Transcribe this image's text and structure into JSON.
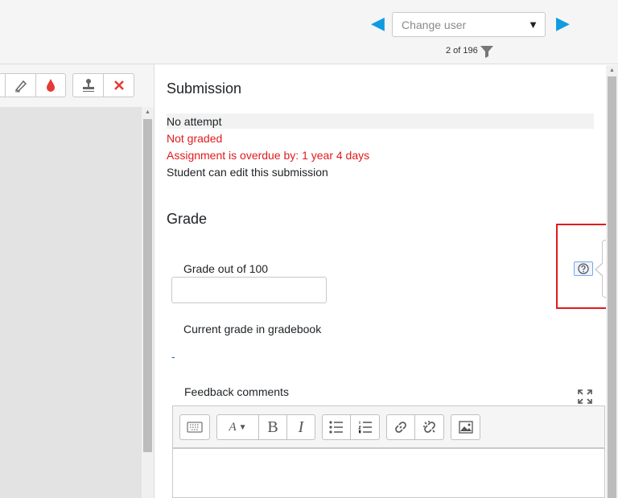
{
  "header": {
    "prev_icon": "left-triangle-icon",
    "next_icon": "right-triangle-icon",
    "user_select": {
      "placeholder": "Change user",
      "caret": "▼"
    },
    "counter": "2 of 196",
    "filter_icon": "filter-icon"
  },
  "pdf_toolbar": {
    "group1": [
      "highlight-icon",
      "pen-icon",
      "color-drop-icon"
    ],
    "group2": [
      "stamp-icon",
      "delete-icon"
    ]
  },
  "submission": {
    "heading": "Submission",
    "status": "No attempt",
    "grading_status": "Not graded",
    "overdue": "Assignment is overdue by: 1 year 4 days",
    "editable": "Student can edit this submission"
  },
  "grade": {
    "heading": "Grade",
    "grade_label": "Grade out of 100",
    "grade_value": "",
    "gradebook_label": "Current grade in gradebook",
    "gradebook_value": "-",
    "help_icon": "help-icon"
  },
  "feedback": {
    "label": "Feedback comments",
    "expand_icon": "fullscreen-icon",
    "toolbar": [
      "keyboard-icon",
      "font-style-icon",
      "bold-icon",
      "italic-icon",
      "bullet-list-icon",
      "numbered-list-icon",
      "link-icon",
      "unlink-icon",
      "image-icon"
    ],
    "bold_glyph": "B",
    "italic_glyph": "I"
  },
  "colors": {
    "accent": "#0f9ce0",
    "error": "#e01b1b"
  }
}
